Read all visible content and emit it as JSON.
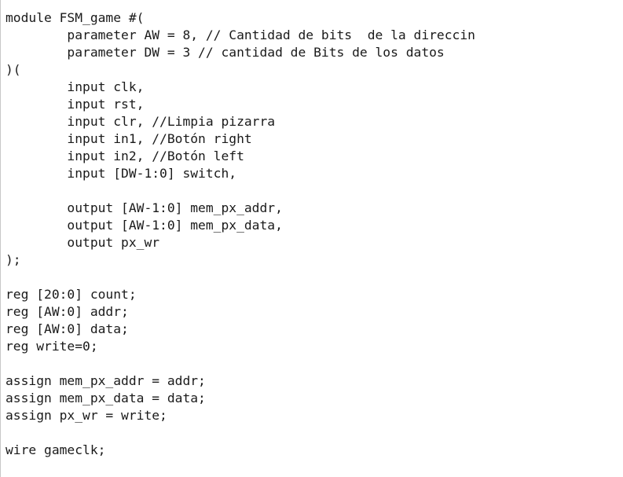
{
  "editor": {
    "lines": [
      "module FSM_game #(",
      "        parameter AW = 8, // Cantidad de bits  de la direccin",
      "        parameter DW = 3 // cantidad de Bits de los datos",
      ")(",
      "        input clk,",
      "        input rst,",
      "        input clr, //Limpia pizarra",
      "        input in1, //Botón right",
      "        input in2, //Botón left",
      "        input [DW-1:0] switch,",
      "",
      "        output [AW-1:0] mem_px_addr,",
      "        output [AW-1:0] mem_px_data,",
      "        output px_wr",
      ");",
      "",
      "reg [20:0] count;",
      "reg [AW:0] addr;",
      "reg [AW:0] data;",
      "reg write=0;",
      "",
      "assign mem_px_addr = addr;",
      "assign mem_px_data = data;",
      "assign px_wr = write;",
      "",
      "wire gameclk;"
    ]
  }
}
